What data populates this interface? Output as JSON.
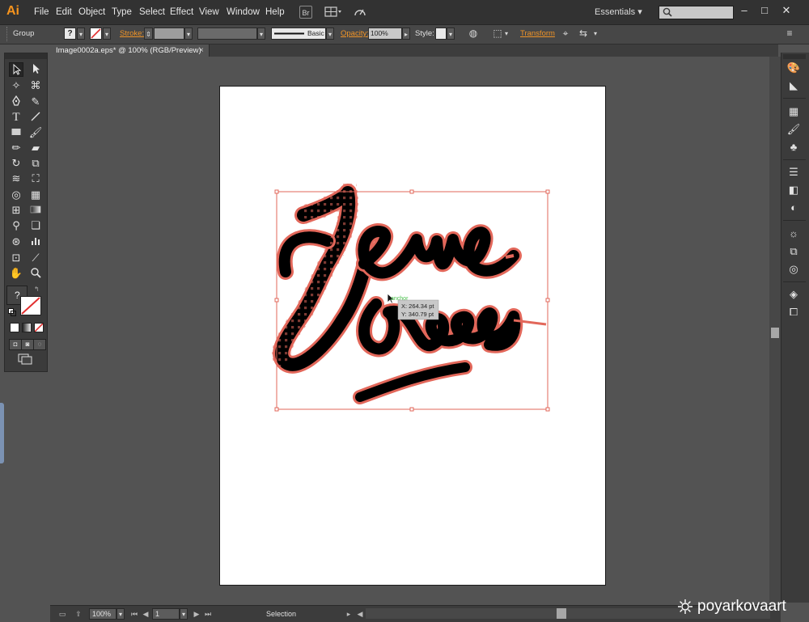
{
  "app": {
    "logo": "Ai"
  },
  "menu": [
    "File",
    "Edit",
    "Object",
    "Type",
    "Select",
    "Effect",
    "View",
    "Window",
    "Help"
  ],
  "menubar_icons": {
    "bridge": "Br",
    "arrange": "arrange-documents-icon",
    "sync": "gpu-performance-icon"
  },
  "workspace": {
    "label": "Essentials ▾"
  },
  "window_controls": {
    "minimize": "–",
    "maximize": "□",
    "close": "✕"
  },
  "control_bar": {
    "selection_type": "Group",
    "fill_value": "?",
    "stroke_label": "Stroke:",
    "brush_label": "Basic",
    "opacity_label": "Opacity:",
    "opacity_value": "100%",
    "style_label": "Style:",
    "transform_label": "Transform"
  },
  "document_tab": {
    "title": "Image0002a.eps* @ 100% (RGB/Preview)",
    "close": "×"
  },
  "canvas": {
    "artwork_words": [
      "Jeans",
      "Goods"
    ],
    "cursor_label": "anchor",
    "readout": {
      "x": "X: 264.34 pt",
      "y": "Y: 340.79 pt"
    },
    "highlight_color": "#e2675a"
  },
  "tools_panel": {
    "fill_stroke_question": "?"
  },
  "status_bar": {
    "zoom": "100%",
    "artboard_number": "1",
    "tool_name": "Selection"
  },
  "watermark": {
    "text": "poyarkovaart"
  }
}
